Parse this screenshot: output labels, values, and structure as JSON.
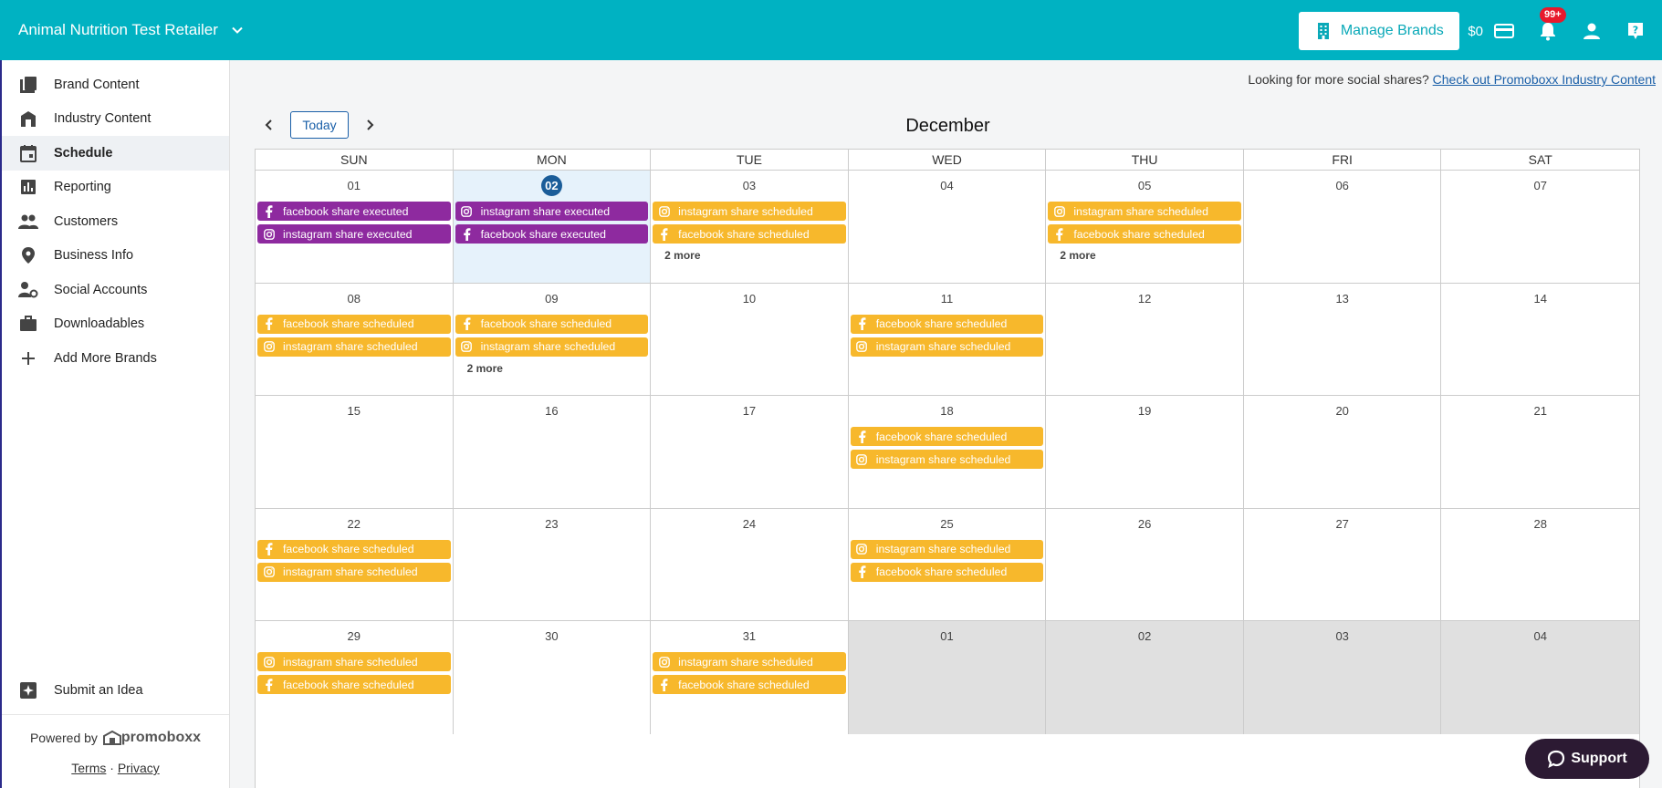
{
  "header": {
    "retailer_name": "Animal Nutrition Test Retailer",
    "manage_brands_label": "Manage Brands",
    "balance": "$0",
    "notification_count": "99+",
    "colors": {
      "primary": "#00b2c2",
      "badge": "#e8192c"
    }
  },
  "sidebar": {
    "items": [
      {
        "label": "Brand Content",
        "icon": "library-icon"
      },
      {
        "label": "Industry Content",
        "icon": "storefront-icon"
      },
      {
        "label": "Schedule",
        "icon": "calendar-icon",
        "active": true
      },
      {
        "label": "Reporting",
        "icon": "bar-chart-icon"
      },
      {
        "label": "Customers",
        "icon": "people-icon"
      },
      {
        "label": "Business Info",
        "icon": "location-pin-icon"
      },
      {
        "label": "Social Accounts",
        "icon": "user-gear-icon"
      },
      {
        "label": "Downloadables",
        "icon": "briefcase-icon"
      },
      {
        "label": "Add More Brands",
        "icon": "plus-icon"
      }
    ],
    "submit_idea_label": "Submit an Idea",
    "powered_by": "Powered by",
    "logo_text": "promoboxx",
    "terms": "Terms",
    "separator": "·",
    "privacy": "Privacy"
  },
  "main": {
    "promo_text": "Looking for more social shares?",
    "promo_link": "Check out Promoboxx Industry Content",
    "today_label": "Today",
    "month": "December",
    "days_of_week": [
      "SUN",
      "MON",
      "TUE",
      "WED",
      "THU",
      "FRI",
      "SAT"
    ],
    "support_label": "Support",
    "event_colors": {
      "executed": "#8e2a9f",
      "scheduled": "#f7b82c"
    }
  },
  "calendar": {
    "weeks": [
      [
        {
          "num": "01",
          "events": [
            {
              "network": "facebook",
              "text": "facebook share executed",
              "status": "executed"
            },
            {
              "network": "instagram",
              "text": "instagram share executed",
              "status": "executed"
            }
          ]
        },
        {
          "num": "02",
          "today": true,
          "events": [
            {
              "network": "instagram",
              "text": "instagram share executed",
              "status": "executed"
            },
            {
              "network": "facebook",
              "text": "facebook share executed",
              "status": "executed"
            }
          ]
        },
        {
          "num": "03",
          "events": [
            {
              "network": "instagram",
              "text": "instagram share scheduled",
              "status": "scheduled"
            },
            {
              "network": "facebook",
              "text": "facebook share scheduled",
              "status": "scheduled"
            }
          ],
          "more": "2 more"
        },
        {
          "num": "04",
          "events": []
        },
        {
          "num": "05",
          "events": [
            {
              "network": "instagram",
              "text": "instagram share scheduled",
              "status": "scheduled"
            },
            {
              "network": "facebook",
              "text": "facebook share scheduled",
              "status": "scheduled"
            }
          ],
          "more": "2 more"
        },
        {
          "num": "06",
          "events": []
        },
        {
          "num": "07",
          "events": []
        }
      ],
      [
        {
          "num": "08",
          "events": [
            {
              "network": "facebook",
              "text": "facebook share scheduled",
              "status": "scheduled"
            },
            {
              "network": "instagram",
              "text": "instagram share scheduled",
              "status": "scheduled"
            }
          ]
        },
        {
          "num": "09",
          "events": [
            {
              "network": "facebook",
              "text": "facebook share scheduled",
              "status": "scheduled"
            },
            {
              "network": "instagram",
              "text": "instagram share scheduled",
              "status": "scheduled"
            }
          ],
          "more": "2 more"
        },
        {
          "num": "10",
          "events": []
        },
        {
          "num": "11",
          "events": [
            {
              "network": "facebook",
              "text": "facebook share scheduled",
              "status": "scheduled"
            },
            {
              "network": "instagram",
              "text": "instagram share scheduled",
              "status": "scheduled"
            }
          ]
        },
        {
          "num": "12",
          "events": []
        },
        {
          "num": "13",
          "events": []
        },
        {
          "num": "14",
          "events": []
        }
      ],
      [
        {
          "num": "15",
          "events": []
        },
        {
          "num": "16",
          "events": []
        },
        {
          "num": "17",
          "events": []
        },
        {
          "num": "18",
          "events": [
            {
              "network": "facebook",
              "text": "facebook share scheduled",
              "status": "scheduled"
            },
            {
              "network": "instagram",
              "text": "instagram share scheduled",
              "status": "scheduled"
            }
          ]
        },
        {
          "num": "19",
          "events": []
        },
        {
          "num": "20",
          "events": []
        },
        {
          "num": "21",
          "events": []
        }
      ],
      [
        {
          "num": "22",
          "events": [
            {
              "network": "facebook",
              "text": "facebook share scheduled",
              "status": "scheduled"
            },
            {
              "network": "instagram",
              "text": "instagram share scheduled",
              "status": "scheduled"
            }
          ]
        },
        {
          "num": "23",
          "events": []
        },
        {
          "num": "24",
          "events": []
        },
        {
          "num": "25",
          "events": [
            {
              "network": "instagram",
              "text": "instagram share scheduled",
              "status": "scheduled"
            },
            {
              "network": "facebook",
              "text": "facebook share scheduled",
              "status": "scheduled"
            }
          ]
        },
        {
          "num": "26",
          "events": []
        },
        {
          "num": "27",
          "events": []
        },
        {
          "num": "28",
          "events": []
        }
      ],
      [
        {
          "num": "29",
          "events": [
            {
              "network": "instagram",
              "text": "instagram share scheduled",
              "status": "scheduled"
            },
            {
              "network": "facebook",
              "text": "facebook share scheduled",
              "status": "scheduled"
            }
          ]
        },
        {
          "num": "30",
          "events": []
        },
        {
          "num": "31",
          "events": [
            {
              "network": "instagram",
              "text": "instagram share scheduled",
              "status": "scheduled"
            },
            {
              "network": "facebook",
              "text": "facebook share scheduled",
              "status": "scheduled"
            }
          ]
        },
        {
          "num": "01",
          "other": true,
          "events": []
        },
        {
          "num": "02",
          "other": true,
          "events": []
        },
        {
          "num": "03",
          "other": true,
          "events": []
        },
        {
          "num": "04",
          "other": true,
          "events": []
        }
      ]
    ]
  }
}
